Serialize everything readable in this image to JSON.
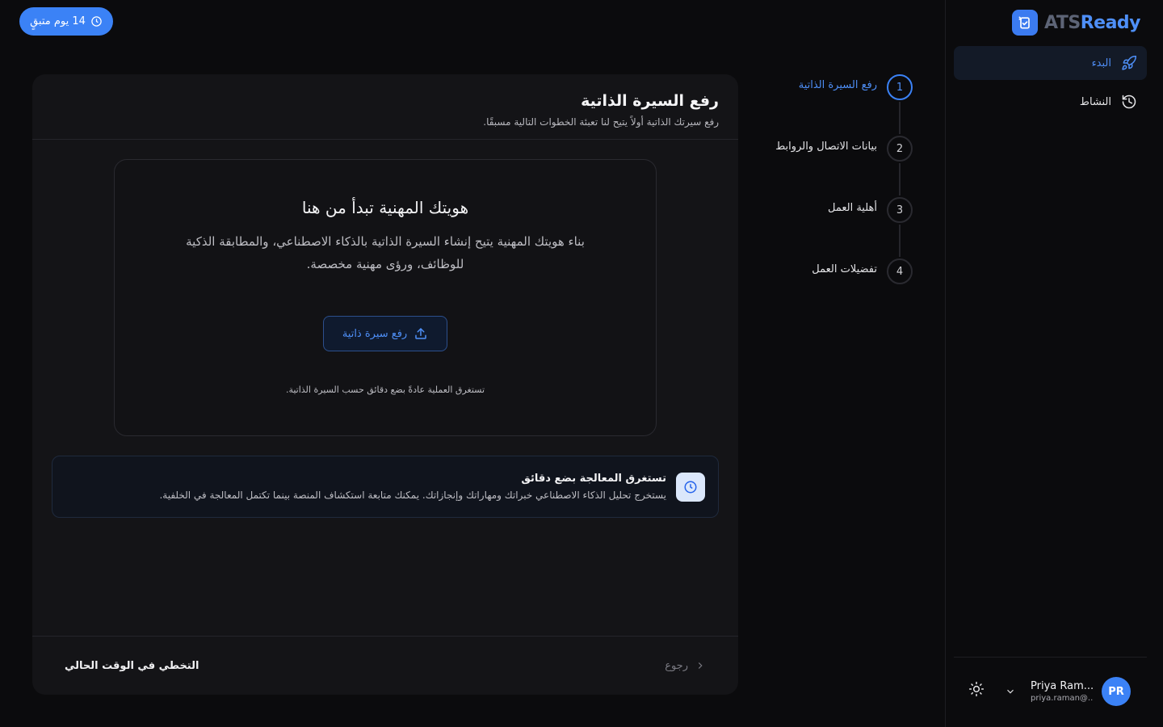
{
  "trial": {
    "label": "14 يوم متبقٍ"
  },
  "logo": {
    "part1": "ATS",
    "part2": "Ready"
  },
  "sidebar": {
    "items": [
      {
        "label": "البدء",
        "icon": "rocket-icon",
        "active": true
      },
      {
        "label": "النشاط",
        "icon": "history-icon",
        "active": false
      }
    ]
  },
  "user": {
    "initials": "PR",
    "name": "Priya Ram...",
    "email": "priya.raman@..."
  },
  "stepper": {
    "steps": [
      {
        "number": "1",
        "label": "رفع السيرة الذاتية",
        "active": true
      },
      {
        "number": "2",
        "label": "بيانات الاتصال والروابط",
        "active": false
      },
      {
        "number": "3",
        "label": "أهلية العمل",
        "active": false
      },
      {
        "number": "4",
        "label": "تفضيلات العمل",
        "active": false
      }
    ]
  },
  "card": {
    "title": "رفع السيرة الذاتية",
    "subtitle": "رفع سيرتك الذاتية أولاً يتيح لنا تعبئة الخطوات التالية مسبقًا."
  },
  "upload": {
    "heading": "هويتك المهنية تبدأ من هنا",
    "description": "بناء هويتك المهنية يتيح إنشاء السيرة الذاتية بالذكاء الاصطناعي، والمطابقة الذكية للوظائف، ورؤى مهنية مخصصة.",
    "button_label": "رفع سيرة ذاتية",
    "note": "تستغرق العملية عادةً بضع دقائق حسب السيرة الذاتية."
  },
  "info": {
    "title": "تستغرق المعالجة بضع دقائق",
    "description": "يستخرج تحليل الذكاء الاصطناعي خبراتك ومهاراتك وإنجازاتك. يمكنك متابعة استكشاف المنصة بينما تكتمل المعالجة في الخلفية."
  },
  "footer": {
    "back_label": "رجوع",
    "skip_label": "التخطي في الوقت الحالي"
  },
  "colors": {
    "accent": "#3b82f6",
    "background": "#0b0b0d",
    "card": "#141417"
  }
}
